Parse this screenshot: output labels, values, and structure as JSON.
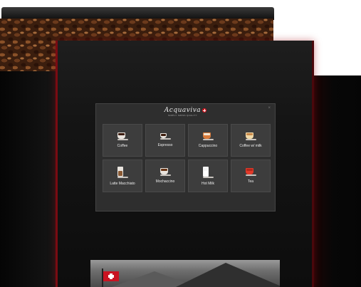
{
  "screen": {
    "brand": {
      "name": "Acquaviva",
      "tagline": "SIMPLY SWISS QUALITY",
      "icon": "swiss-cross-icon"
    },
    "close_symbol": "×",
    "drinks": [
      {
        "label": "Coffee",
        "icon": "coffee-cup-icon"
      },
      {
        "label": "Espresso",
        "icon": "espresso-cup-icon"
      },
      {
        "label": "Cappuccino",
        "icon": "cappuccino-cup-icon"
      },
      {
        "label": "Coffee w/ milk",
        "icon": "coffee-with-milk-cup-icon"
      },
      {
        "label": "Latte Macchiato",
        "icon": "latte-glass-icon"
      },
      {
        "label": "Mochaccino",
        "icon": "mochaccino-cup-icon"
      },
      {
        "label": "Hot Milk",
        "icon": "hot-milk-glass-icon"
      },
      {
        "label": "Tea",
        "icon": "tea-cup-icon"
      }
    ]
  },
  "colors": {
    "machine_body": "#111111",
    "accent_red": "#7a0b12",
    "screen_bg": "#2e2e2e",
    "tile_bg": "#3d3d3d"
  }
}
